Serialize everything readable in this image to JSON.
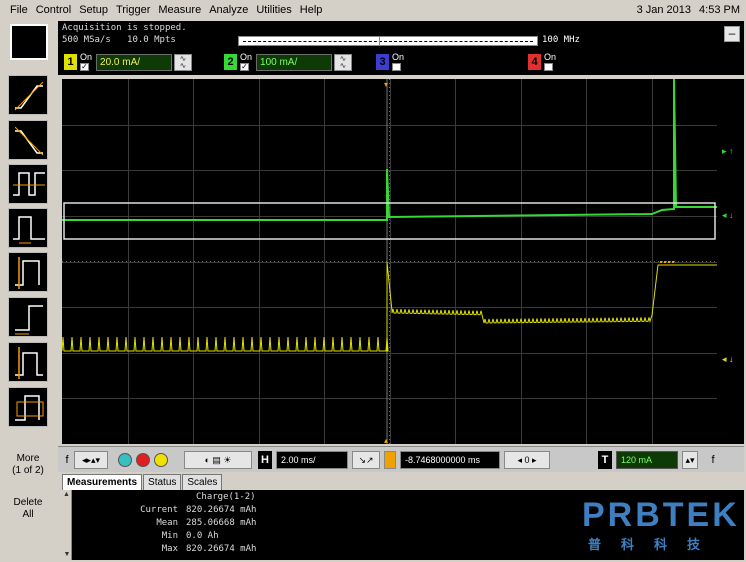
{
  "menu": {
    "items": [
      "File",
      "Control",
      "Setup",
      "Trigger",
      "Measure",
      "Analyze",
      "Utilities",
      "Help"
    ],
    "date": "3 Jan 2013",
    "time": "4:53 PM"
  },
  "status": {
    "acquisition": "Acquisition is stopped.",
    "sample_rate": "500 MSa/s",
    "memory_depth": "10.0 Mpts",
    "bandwidth": "100 MHz"
  },
  "channels": [
    {
      "number": "1",
      "on_label": "On",
      "checked": true,
      "scale": "20.0 mA/",
      "color": "#e0e000"
    },
    {
      "number": "2",
      "on_label": "On",
      "checked": true,
      "scale": "100 mA/",
      "color": "#35d835"
    },
    {
      "number": "3",
      "on_label": "On",
      "checked": false,
      "scale": "",
      "color": "#3c3cd0"
    },
    {
      "number": "4",
      "on_label": "On",
      "checked": false,
      "scale": "",
      "color": "#e03030"
    }
  ],
  "toolbar": {
    "more_label": "More",
    "more_pages": "(1 of 2)",
    "delete_label": "Delete",
    "delete_all_label": "All"
  },
  "controls": {
    "horizontal_letter": "H",
    "horizontal_scale": "2.00 ms/",
    "trigger_position": "-8.7468000000 ms",
    "trigger_letter": "T",
    "trigger_level": "120 mA",
    "info_symbol": "f"
  },
  "tabs": [
    "Measurements",
    "Status",
    "Scales"
  ],
  "measurements": {
    "title": "Charge(1-2)",
    "rows": [
      {
        "label": "Current",
        "value": "820.26674 mAh"
      },
      {
        "label": "Mean",
        "value": "285.06668 mAh"
      },
      {
        "label": "Min",
        "value": "0.0 Ah"
      },
      {
        "label": "Max",
        "value": "820.26674 mAh"
      }
    ]
  },
  "watermark": {
    "text": "PRBTEK",
    "subtext": "普科科技"
  },
  "colors": {
    "channel1": "#e0e000",
    "channel2": "#35d835",
    "grid": "#3a3a3a",
    "background": "#000000"
  }
}
